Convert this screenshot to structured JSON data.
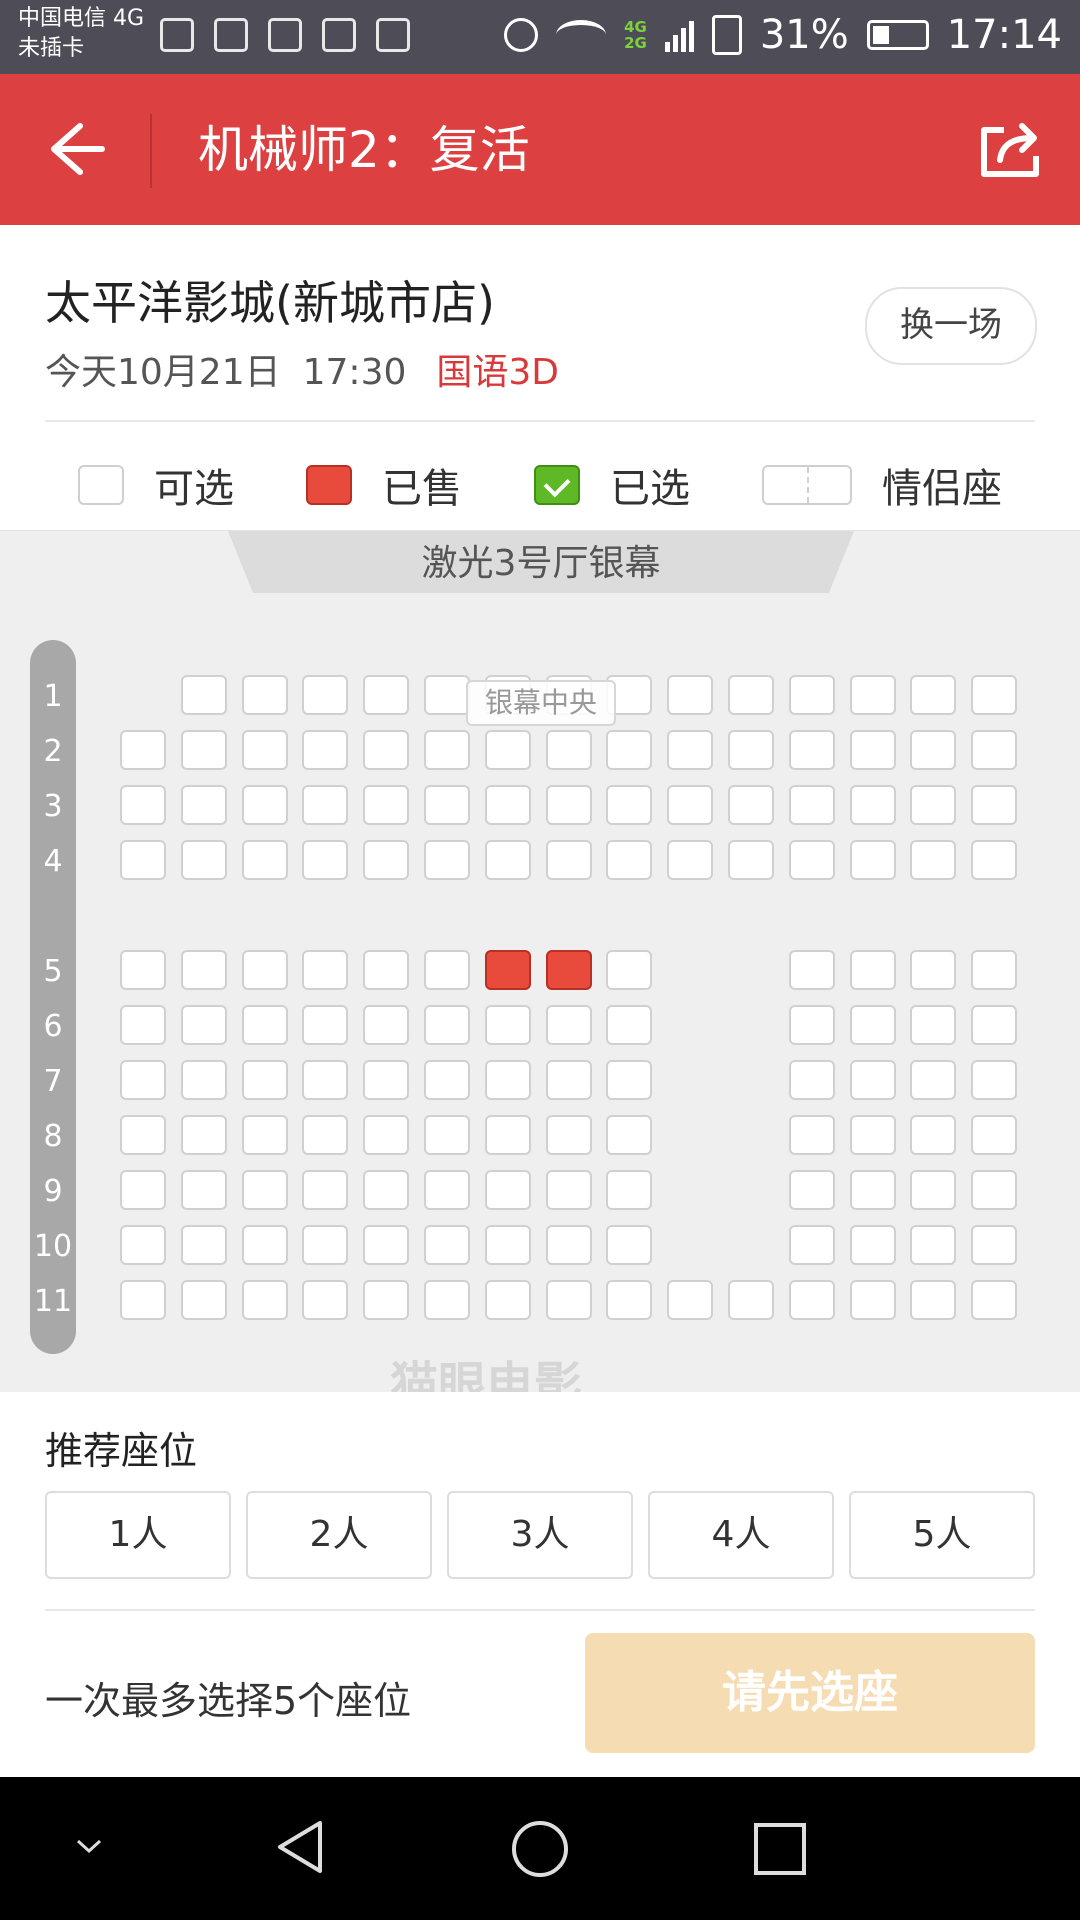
{
  "status_bar": {
    "carrier": "中国电信 4G",
    "sim_state": "未插卡",
    "network_top": "4G",
    "network_bottom": "2G",
    "battery": "31%",
    "time": "17:14"
  },
  "header": {
    "title": "机械师2：复活",
    "back_icon": "back-arrow-icon",
    "share_icon": "share-icon",
    "background_color": "#dd4040"
  },
  "show_info": {
    "cinema_name": "太平洋影城(新城市店)",
    "date": "今天10月21日",
    "time": "17:30",
    "language_format": "国语3D",
    "change_button": "换一场"
  },
  "legend": {
    "available": "可选",
    "sold": "已售",
    "selected": "已选",
    "couple": "情侣座"
  },
  "hall": {
    "screen_label": "激光3号厅银幕",
    "center_label": "银幕中央",
    "watermark": "猫眼电影",
    "row_labels": [
      "1",
      "2",
      "3",
      "4",
      "5",
      "6",
      "7",
      "8",
      "9",
      "10",
      "11"
    ],
    "sold_seats": [
      [
        "5",
        7
      ],
      [
        "5",
        8
      ]
    ]
  },
  "recommend": {
    "title": "推荐座位",
    "options": [
      "1人",
      "2人",
      "3人",
      "4人",
      "5人"
    ]
  },
  "footer": {
    "max_note": "一次最多选择5个座位",
    "confirm_button": "请先选座"
  }
}
